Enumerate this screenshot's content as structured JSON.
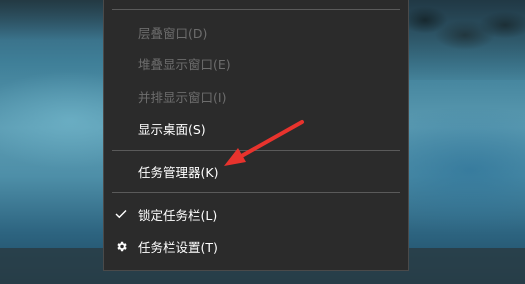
{
  "context_menu": {
    "items": [
      {
        "id": "cascade",
        "label": "层叠窗口(D)",
        "enabled": false
      },
      {
        "id": "stack",
        "label": "堆叠显示窗口(E)",
        "enabled": false
      },
      {
        "id": "side_by_side",
        "label": "并排显示窗口(I)",
        "enabled": false
      },
      {
        "id": "show_desktop",
        "label": "显示桌面(S)",
        "enabled": true
      },
      {
        "id": "task_manager",
        "label": "任务管理器(K)",
        "enabled": true
      },
      {
        "id": "lock_taskbar",
        "label": "锁定任务栏(L)",
        "enabled": true,
        "checked": true,
        "icon": "checkmark-icon"
      },
      {
        "id": "taskbar_settings",
        "label": "任务栏设置(T)",
        "enabled": true,
        "icon": "gear-icon"
      }
    ]
  },
  "annotation": {
    "color": "#e8332d",
    "points_to": "task_manager"
  },
  "colors": {
    "menu_bg": "#2b2b2b",
    "disabled_text": "#6d6d6d",
    "text": "#ffffff",
    "separator": "#5a5a5a"
  }
}
